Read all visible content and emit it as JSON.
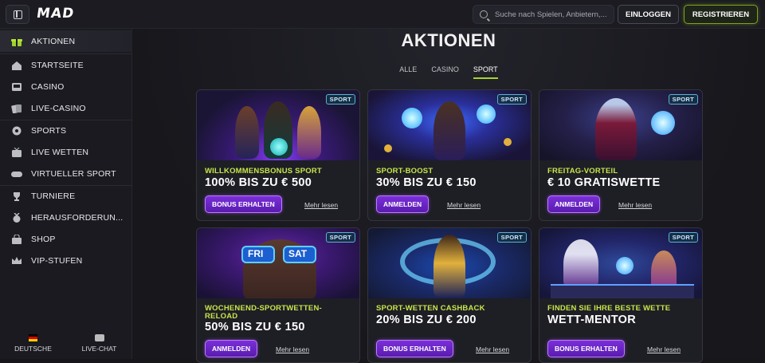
{
  "header": {
    "logo": "MAD",
    "search_placeholder": "Suche nach Spielen, Anbietern,...",
    "login_label": "EINLOGGEN",
    "register_label": "REGISTRIEREN",
    "accent_color": "#a6d22e"
  },
  "sidebar": {
    "items": [
      {
        "label": "AKTIONEN",
        "icon": "gift-icon",
        "active": true
      },
      {
        "label": "STARTSEITE",
        "icon": "home-icon"
      },
      {
        "label": "CASINO",
        "icon": "slot-machine-icon"
      },
      {
        "label": "LIVE-CASINO",
        "icon": "cards-icon"
      },
      {
        "label": "SPORTS",
        "icon": "soccer-ball-icon"
      },
      {
        "label": "LIVE WETTEN",
        "icon": "tv-icon"
      },
      {
        "label": "VIRTUELLER SPORT",
        "icon": "gamepad-icon"
      },
      {
        "label": "TURNIERE",
        "icon": "trophy-icon"
      },
      {
        "label": "HERAUSFORDERUN...",
        "icon": "medal-icon"
      },
      {
        "label": "SHOP",
        "icon": "shop-bag-icon"
      },
      {
        "label": "VIP-STUFEN",
        "icon": "crown-icon"
      }
    ],
    "language_label": "DEUTSCHE",
    "chat_label": "LIVE-CHAT"
  },
  "main": {
    "title": "AKTIONEN",
    "tabs": [
      {
        "label": "ALLE"
      },
      {
        "label": "CASINO"
      },
      {
        "label": "SPORT",
        "active": true
      }
    ],
    "cards": [
      {
        "badge": "SPORT",
        "category": "WILLKOMMENSBONUS SPORT",
        "headline": "100% BIS ZU € 500",
        "cta": "BONUS ERHALTEN",
        "more": "Mehr lesen"
      },
      {
        "badge": "SPORT",
        "category": "SPORT-BOOST",
        "headline": "30% BIS ZU € 150",
        "cta": "ANMELDEN",
        "more": "Mehr lesen"
      },
      {
        "badge": "SPORT",
        "category": "FREITAG-VORTEIL",
        "headline": "€ 10 GRATISWETTE",
        "cta": "ANMELDEN",
        "more": "Mehr lesen"
      },
      {
        "badge": "SPORT",
        "category": "WOCHENEND-SPORTWETTEN-RELOAD",
        "headline": "50% BIS ZU € 150",
        "cta": "ANMELDEN",
        "more": "Mehr lesen"
      },
      {
        "badge": "SPORT",
        "category": "SPORT-WETTEN CASHBACK",
        "headline": "20% BIS ZU € 200",
        "cta": "BONUS ERHALTEN",
        "more": "Mehr lesen"
      },
      {
        "badge": "SPORT",
        "category": "FINDEN SIE IHRE BESTE WETTE",
        "headline": "WETT-MENTOR",
        "cta": "BONUS ERHALTEN",
        "more": "Mehr lesen"
      }
    ],
    "card_art_text": {
      "fri": "FRI",
      "sat": "SAT"
    }
  }
}
